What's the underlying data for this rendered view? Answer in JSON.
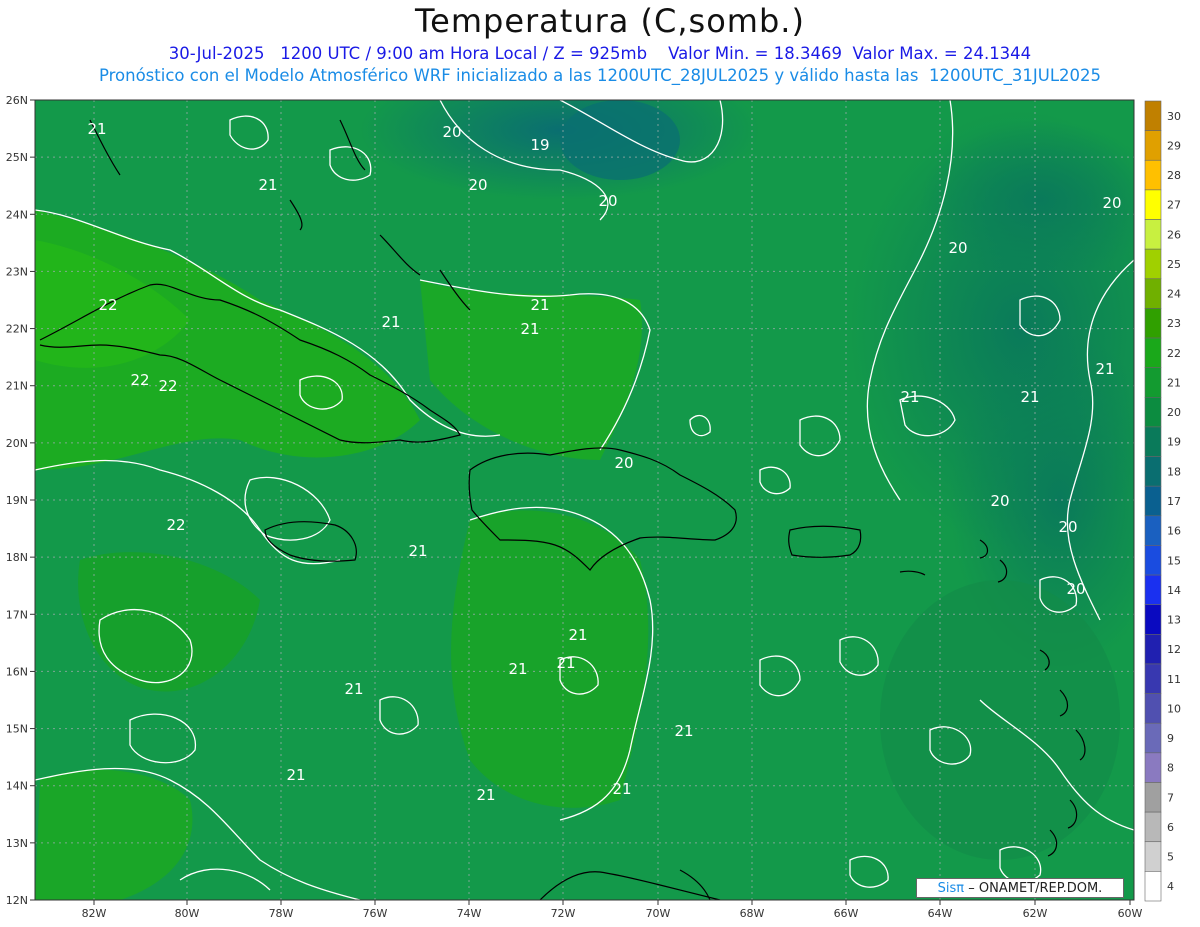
{
  "header": {
    "title": "Temperatura (C,somb.)",
    "line1": "30-Jul-2025   1200 UTC / 9:00 am Hora Local / Z = 925mb    Valor Min. = 18.3469  Valor Max. = 24.1344",
    "line2": "Pronóstico con el Modelo Atmosférico WRF inicializado a las 1200UTC_28JUL2025 y válido hasta las  1200UTC_31JUL2025"
  },
  "map": {
    "lat_ticks": [
      "26N",
      "25N",
      "24N",
      "23N",
      "22N",
      "21N",
      "20N",
      "19N",
      "18N",
      "17N",
      "16N",
      "15N",
      "14N",
      "13N",
      "12N"
    ],
    "lon_ticks": [
      "82W",
      "80W",
      "78W",
      "76W",
      "74W",
      "72W",
      "70W",
      "68W",
      "66W",
      "64W",
      "62W",
      "60W"
    ],
    "contour_labels": [
      "21",
      "20",
      "19",
      "20",
      "20",
      "20",
      "20",
      "21",
      "21",
      "21",
      "22",
      "22",
      "22",
      "22",
      "21",
      "21",
      "21",
      "20",
      "20",
      "20",
      "20",
      "21",
      "21",
      "21",
      "21",
      "21",
      "21",
      "21",
      "21",
      "21",
      "21"
    ]
  },
  "colorbar": {
    "levels": [
      "30",
      "29",
      "28",
      "27",
      "26",
      "25",
      "24",
      "23",
      "22",
      "21",
      "20",
      "19",
      "18",
      "17",
      "16",
      "15",
      "14",
      "13",
      "12",
      "11",
      "10",
      "9",
      "8",
      "7",
      "6",
      "5",
      "4"
    ],
    "colors": [
      "#c08000",
      "#e0a000",
      "#ffc000",
      "#ffff00",
      "#c8f040",
      "#a0d000",
      "#70b000",
      "#30a000",
      "#1aa81a",
      "#139b30",
      "#0c8c40",
      "#0a7a5a",
      "#0a6e70",
      "#0a6090",
      "#1a60c0",
      "#1a4ce0",
      "#1a30f0",
      "#0a0ac0",
      "#2020b0",
      "#3838b0",
      "#5050b0",
      "#6a6ab8",
      "#8a7ac0",
      "#a0a0a0",
      "#b8b8b8",
      "#d0d0d0",
      "#ffffff"
    ]
  },
  "credit": {
    "logo_text": "Sisπ",
    "text": "– ONAMET/REP.DOM."
  }
}
